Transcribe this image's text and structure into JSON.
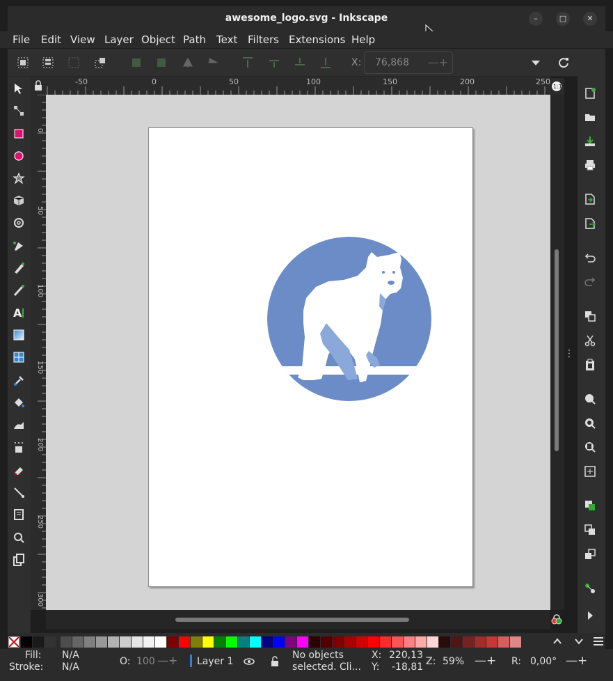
{
  "window": {
    "title": "awesome_logo.svg - Inkscape"
  },
  "menu": [
    "File",
    "Edit",
    "View",
    "Layer",
    "Object",
    "Path",
    "Text",
    "Filters",
    "Extensions",
    "Help"
  ],
  "toolbar": {
    "x_label": "X:",
    "x_value": "76,868"
  },
  "ruler": {
    "top_labels": [
      "-50",
      "0",
      "50",
      "100",
      "150",
      "200",
      "250"
    ],
    "left_labels": [
      "0",
      "50",
      "100",
      "150",
      "200",
      "250",
      "300"
    ]
  },
  "status": {
    "fill_label": "Fill:",
    "fill_value": "N/A",
    "stroke_label": "Stroke:",
    "stroke_value": "N/A",
    "opacity_label": "O:",
    "opacity_value": "100",
    "layer_name": "Layer 1",
    "message_line1": "No objects",
    "message_line2": "selected. Cli...",
    "cursor_x_label": "X:",
    "cursor_x": "220,13",
    "cursor_y_label": "Y:",
    "cursor_y": "-18,81",
    "zoom_label": "Z:",
    "zoom": "59%",
    "rotation_label": "R:",
    "rotation": "0,00°"
  },
  "colors": {
    "logo_blue": "#6b8cc7",
    "logo_light": "#8aa8d9",
    "palette": [
      "#000000",
      "#1a1a1a",
      "#333333",
      "#4d4d4d",
      "#666666",
      "#808080",
      "#999999",
      "#b3b3b3",
      "#cccccc",
      "#e6e6e6",
      "#f2f2f2",
      "#ffffff",
      "#800000",
      "#ff0000",
      "#808000",
      "#ffff00",
      "#008000",
      "#00ff00",
      "#008080",
      "#00ffff",
      "#000080",
      "#0000ff",
      "#800080",
      "#ff00ff",
      "#2b0000",
      "#550000",
      "#800000",
      "#aa0000",
      "#d40000",
      "#ff0000",
      "#ff2a2a",
      "#ff5555",
      "#ff8080",
      "#ffaaaa",
      "#ffd5d5",
      "#280b0b",
      "#501616",
      "#782121",
      "#a02c2c",
      "#c83737",
      "#d35f5f",
      "#de8787"
    ]
  }
}
